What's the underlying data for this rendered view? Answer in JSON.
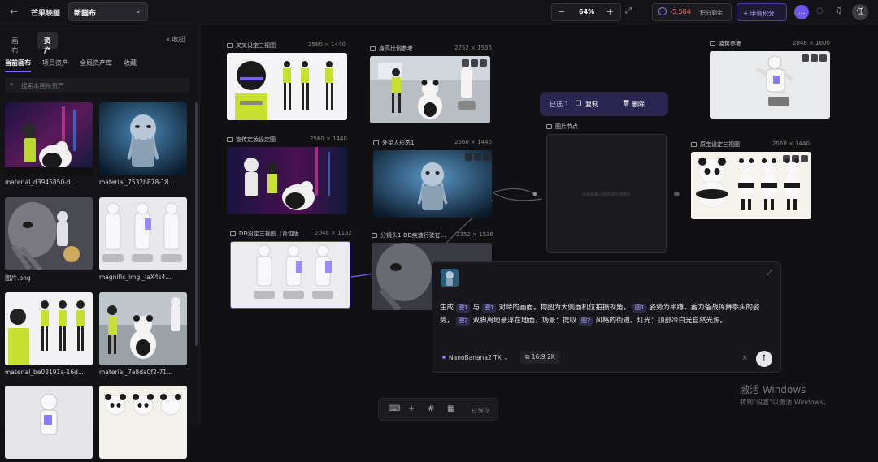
{
  "topbar": {
    "back_glyph": "←",
    "brand": "芒果映画",
    "canvas_name": "新画布",
    "zoom_minus": "−",
    "zoom_value": "64%",
    "zoom_plus": "+",
    "credits_value": "-5,584",
    "credits_label": "积分剩余",
    "apply_label": "+ 申请积分",
    "avatar_text": "任",
    "icons": [
      "back-icon",
      "chevron-down-icon",
      "fit-screen-icon",
      "coin-icon",
      "chat-icon",
      "help-icon",
      "bell-icon"
    ]
  },
  "sidebar": {
    "tabs": [
      "画布",
      "资产"
    ],
    "active_tab": "资产",
    "collapse_label": "« 收起",
    "subtabs": [
      "当前画布",
      "项目资产",
      "全局资产库",
      "收藏"
    ],
    "search_placeholder": "搜索本画布资产",
    "assets": [
      {
        "caption": "material_d3945850-d..."
      },
      {
        "caption": "material_7532b878-18..."
      },
      {
        "caption": "图片.png"
      },
      {
        "caption": "magnific_imgl_laX4s4..."
      },
      {
        "caption": "material_be03191a-16d..."
      },
      {
        "caption": "material_7a8da0f2-71..."
      },
      {
        "caption": ""
      },
      {
        "caption": ""
      }
    ]
  },
  "canvas": {
    "nodes": [
      {
        "title": "叉叉设定三视图",
        "dim": "2560 × 1440"
      },
      {
        "title": "身高比例参考",
        "dim": "2752 × 1536"
      },
      {
        "title": "姿势参考",
        "dim": "2848 × 1600"
      },
      {
        "title": "宣传定妆设定图",
        "dim": "2560 × 1440"
      },
      {
        "title": "外星人形态1",
        "dim": "2560 × 1440"
      },
      {
        "title": "图片节点",
        "dim": ""
      },
      {
        "title": "原宝设定三视图",
        "dim": "2560 × 1440"
      },
      {
        "title": "DD设定三视图（背包版...",
        "dim": "2048 × 1152"
      },
      {
        "title": "分镜头1-DD疾速行驶在...",
        "dim": "2752 × 1536"
      }
    ],
    "selection_bar": {
      "selected": "已选 1",
      "copy": "复制",
      "delete": "删除"
    },
    "empty_node_text": "请在此输入提示词生成图片"
  },
  "prompt": {
    "seg1": "生成",
    "tag_img1": "图1",
    "seg2": "与",
    "tag_img2": "图1",
    "seg3": "对峙的画面，构图为大侧面机位拍摄视角，",
    "tag_img3": "图1",
    "seg4": "姿势为半蹲，蓄力备战挥舞拳头的姿势，",
    "tag_img4": "图2",
    "seg5": "双脚离地悬浮在地面，场景：提取",
    "tag_img5": "图2",
    "seg6": "风格的街道。灯光：顶部冷白光自然光源。",
    "model": "NanoBanana2 TX",
    "ratio": "16:9   2K",
    "clear": "×",
    "send": "↑"
  },
  "bottombar": {
    "saved": "已保存"
  },
  "watermark": {
    "line1": "激活 Windows",
    "line2": "转到“设置”以激活 Windows。"
  }
}
